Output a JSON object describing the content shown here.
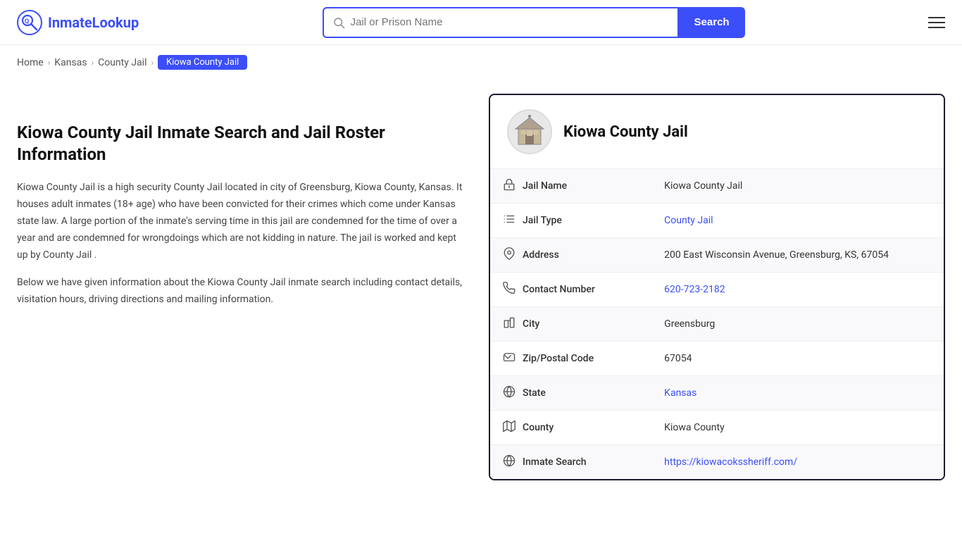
{
  "header": {
    "logo_text_part1": "Inmate",
    "logo_text_part2": "Lookup",
    "search_placeholder": "Jail or Prison Name",
    "search_button_label": "Search"
  },
  "breadcrumb": {
    "items": [
      {
        "label": "Home",
        "href": "#"
      },
      {
        "label": "Kansas",
        "href": "#"
      },
      {
        "label": "County Jail",
        "href": "#"
      },
      {
        "label": "Kiowa County Jail",
        "current": true
      }
    ]
  },
  "left": {
    "title": "Kiowa County Jail Inmate Search and Jail Roster Information",
    "description1": "Kiowa County Jail is a high security County Jail located in city of Greensburg, Kiowa County, Kansas. It houses adult inmates (18+ age) who have been convicted for their crimes which come under Kansas state law. A large portion of the inmate's serving time in this jail are condemned for the time of over a year and are condemned for wrongdoings which are not kidding in nature. The jail is worked and kept up by County Jail .",
    "description2": "Below we have given information about the Kiowa County Jail inmate search including contact details, visitation hours, driving directions and mailing information."
  },
  "card": {
    "title": "Kiowa County Jail",
    "rows": [
      {
        "field": "Jail Name",
        "value": "Kiowa County Jail",
        "icon": "jail-icon",
        "link": false
      },
      {
        "field": "Jail Type",
        "value": "County Jail",
        "icon": "list-icon",
        "link": true,
        "href": "#"
      },
      {
        "field": "Address",
        "value": "200 East Wisconsin Avenue, Greensburg, KS, 67054",
        "icon": "pin-icon",
        "link": false
      },
      {
        "field": "Contact Number",
        "value": "620-723-2182",
        "icon": "phone-icon",
        "link": true,
        "href": "tel:620-723-2182"
      },
      {
        "field": "City",
        "value": "Greensburg",
        "icon": "city-icon",
        "link": false
      },
      {
        "field": "Zip/Postal Code",
        "value": "67054",
        "icon": "mail-icon",
        "link": false
      },
      {
        "field": "State",
        "value": "Kansas",
        "icon": "globe-icon",
        "link": true,
        "href": "#"
      },
      {
        "field": "County",
        "value": "Kiowa County",
        "icon": "map-icon",
        "link": false
      },
      {
        "field": "Inmate Search",
        "value": "https://kiowacokssheriff.com/",
        "icon": "globe2-icon",
        "link": true,
        "href": "https://kiowacokssheriff.com/"
      }
    ]
  }
}
